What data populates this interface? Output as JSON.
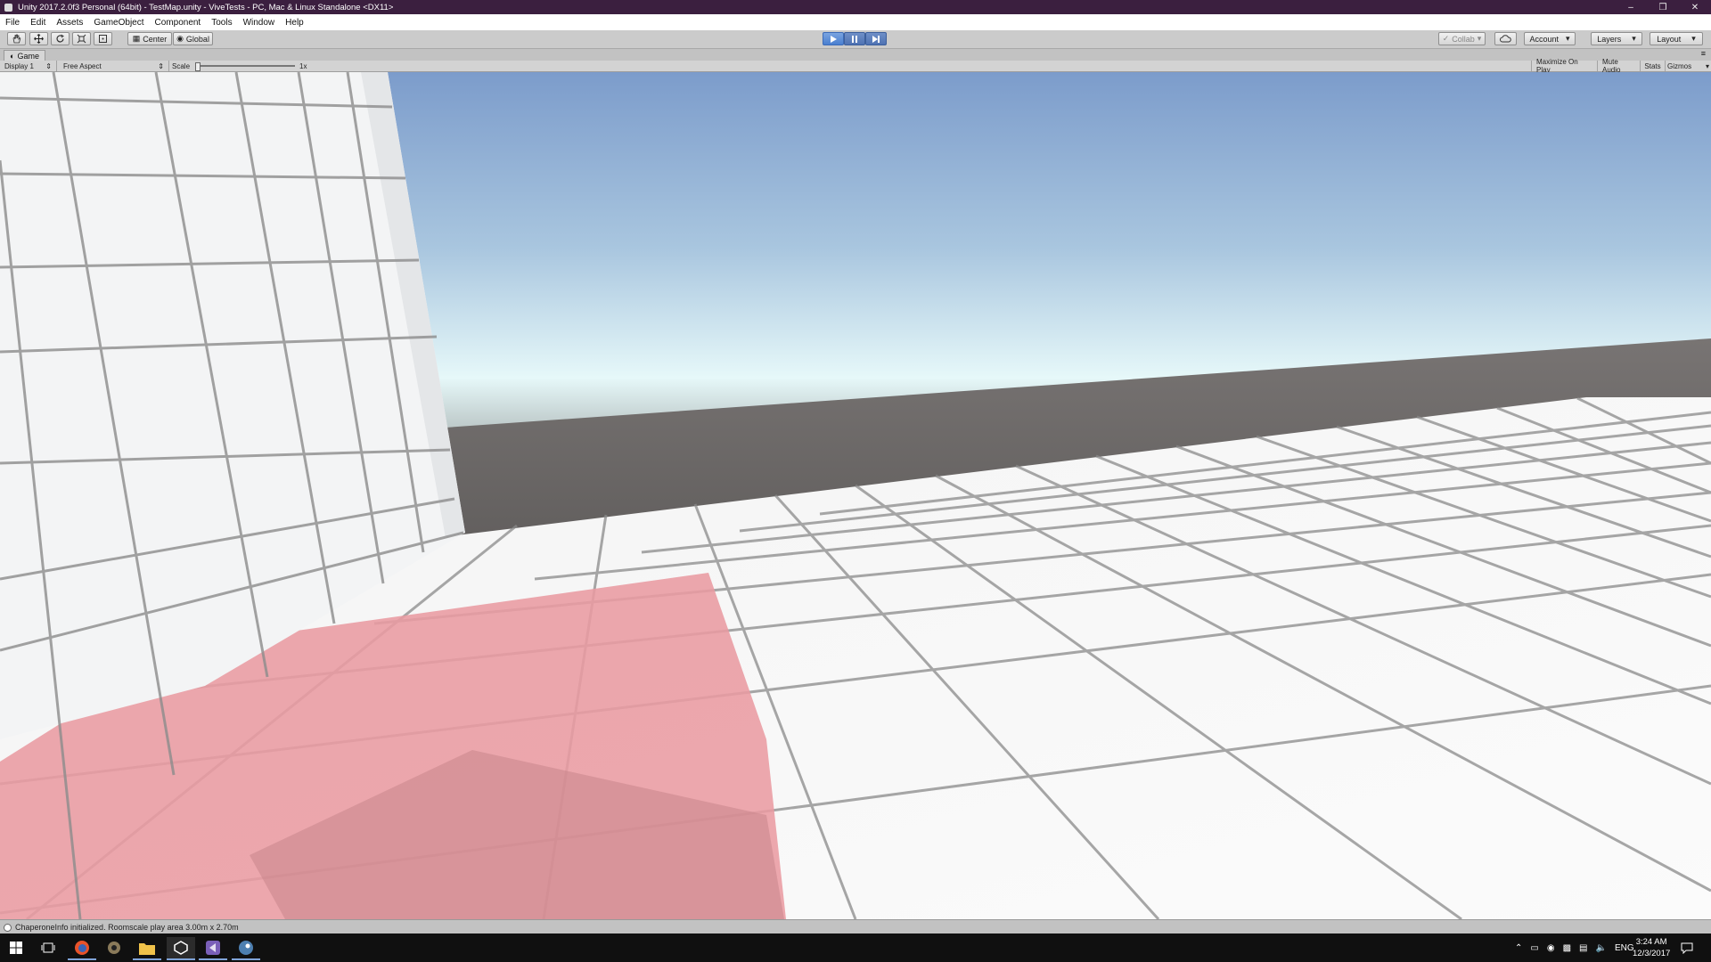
{
  "window": {
    "title": "Unity 2017.2.0f3 Personal (64bit) - TestMap.unity - ViveTests - PC, Mac & Linux Standalone <DX11>",
    "controls": [
      "–",
      "❒",
      "✕"
    ]
  },
  "menu": [
    "File",
    "Edit",
    "Assets",
    "GameObject",
    "Component",
    "Tools",
    "Window",
    "Help"
  ],
  "toolbar": {
    "pivot_label": "Center",
    "space_label": "Global",
    "collab_label": "Collab",
    "account_label": "Account",
    "layers_label": "Layers",
    "layout_label": "Layout"
  },
  "game_tab": {
    "label": "Game"
  },
  "game_bar": {
    "display": "Display 1",
    "aspect": "Free Aspect",
    "scale_label": "Scale",
    "scale_value": "1x",
    "maximize": "Maximize On Play",
    "mute": "Mute Audio",
    "stats": "Stats",
    "gizmos": "Gizmos"
  },
  "status": {
    "message": "ChaperoneInfo initialized. Roomscale play area 3.00m x 2.70m"
  },
  "taskbar": {
    "icons": [
      "windows-start",
      "task-view",
      "firefox",
      "unity-hub",
      "file-explorer",
      "visual-studio",
      "discord",
      "steam"
    ],
    "lang": "ENG",
    "time": "3:24 AM",
    "date": "12/3/2017"
  },
  "colors": {
    "title_bar": "#3b1f3f",
    "play_active": "#4a7fd0",
    "sky_top": "#7f9fcb",
    "horizon": "#e4f6f8",
    "ground_far": "#6a6766",
    "floor": "#f7f7f7",
    "play_area": "#e99ba2"
  }
}
